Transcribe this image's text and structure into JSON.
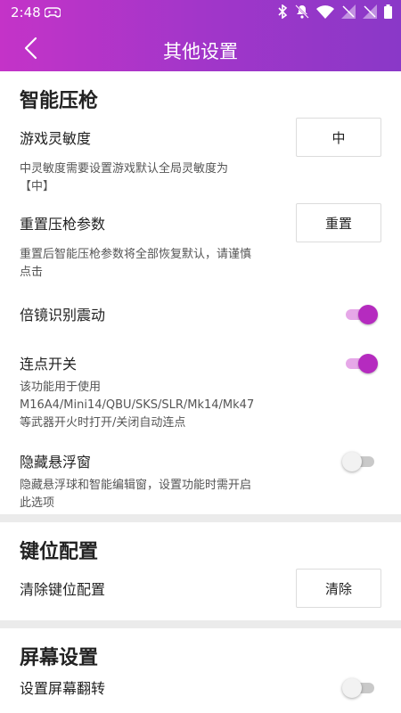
{
  "status_bar": {
    "time": "2:48"
  },
  "header": {
    "title": "其他设置"
  },
  "colors": {
    "accent": "#b52bbf",
    "gradient_start": "#c433c8",
    "gradient_end": "#8a38c8"
  },
  "sections": {
    "smart_recoil": {
      "title": "智能压枪",
      "sensitivity": {
        "label": "游戏灵敏度",
        "value": "中",
        "note": "中灵敏度需要设置游戏默认全局灵敏度为【中】"
      },
      "reset": {
        "label": "重置压枪参数",
        "button": "重置",
        "note": "重置后智能压枪参数将全部恢复默认，请谨慎点击"
      },
      "scope_vibration": {
        "label": "倍镜识别震动",
        "enabled": true
      },
      "burst": {
        "label": "连点开关",
        "enabled": true,
        "note": "该功能用于使用M16A4/Mini14/QBU/SKS/SLR/Mk14/Mk47等武器开火时打开/关闭自动连点"
      },
      "hide_float": {
        "label": "隐藏悬浮窗",
        "enabled": false,
        "note": "隐藏悬浮球和智能编辑窗，设置功能时需开启此选项"
      }
    },
    "keymap": {
      "title": "键位配置",
      "clear": {
        "label": "清除键位配置",
        "button": "清除"
      }
    },
    "screen": {
      "title": "屏幕设置",
      "flip": {
        "label": "设置屏幕翻转",
        "enabled": false
      }
    }
  }
}
